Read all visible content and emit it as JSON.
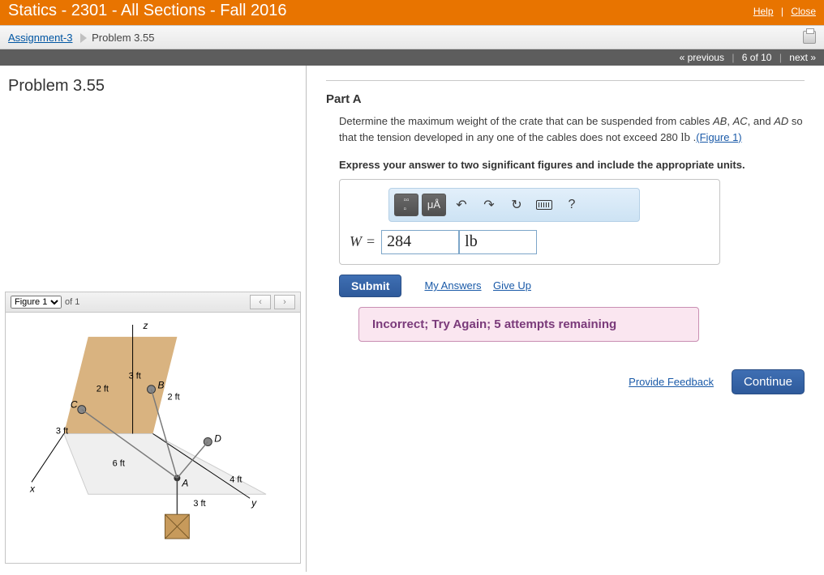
{
  "header": {
    "course_title": "Statics - 2301 - All Sections - Fall 2016",
    "help": "Help",
    "close": "Close"
  },
  "breadcrumb": {
    "assignment_link": "Assignment-3",
    "problem_label": "Problem 3.55"
  },
  "nav": {
    "previous": "« previous",
    "position": "6 of 10",
    "next": "next »"
  },
  "left": {
    "problem_title": "Problem 3.55",
    "figure_select": "Figure 1",
    "of_text": "of 1",
    "prev_btn": "‹",
    "next_btn": "›",
    "diagram": {
      "axis_z": "z",
      "axis_x": "x",
      "axis_y": "y",
      "A": "A",
      "B": "B",
      "C": "C",
      "D": "D",
      "L_2ft_a": "2 ft",
      "L_3ft_a": "3 ft",
      "L_2ft_b": "2 ft",
      "L_3ft_b": "3 ft",
      "L_6ft": "6 ft",
      "L_4ft": "4 ft",
      "L_3ft_c": "3 ft"
    }
  },
  "part": {
    "title": "Part A",
    "prompt_pre": "Determine the maximum weight of the crate that can be suspended from cables ",
    "cable_ab": "AB",
    "cable_ac": "AC",
    "and1": ", and ",
    "cable_ad": "AD",
    "prompt_mid": " so that the tension developed in any one of the cables does not exceed 280 ",
    "unit_lb": "lb",
    "period": " .",
    "figure_link": "(Figure 1)",
    "instruction": "Express your answer to two significant figures and include the appropriate units.",
    "toolbar": {
      "templates": "▢▢",
      "units": "μÅ",
      "undo": "↶",
      "redo": "↷",
      "reset": "↻",
      "keyboard": "kbd",
      "help": "?"
    },
    "var_label": "W",
    "equals": "=",
    "value_input": "284",
    "unit_input": "lb"
  },
  "actions": {
    "submit": "Submit",
    "my_answers": "My Answers",
    "give_up": "Give Up"
  },
  "feedback": "Incorrect; Try Again; 5 attempts remaining",
  "bottom": {
    "provide_feedback": "Provide Feedback",
    "continue": "Continue"
  }
}
